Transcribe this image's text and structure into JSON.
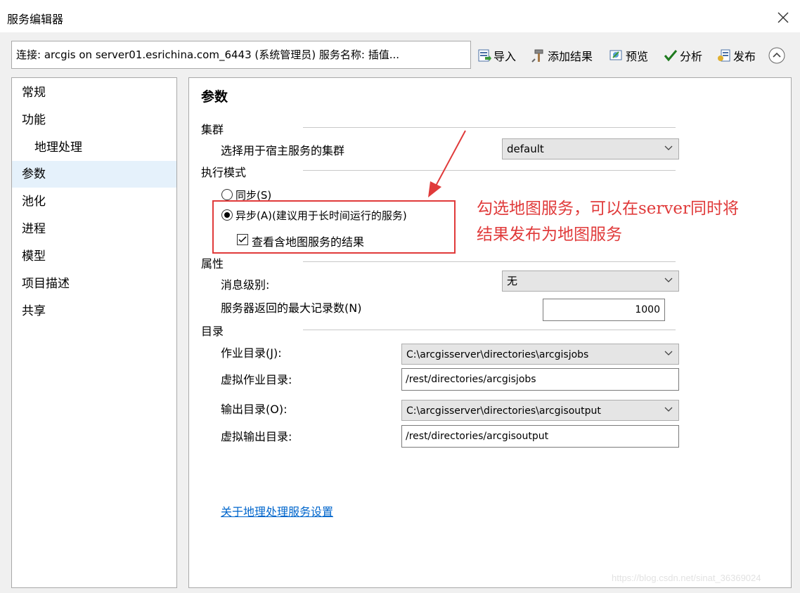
{
  "window": {
    "title": "服务编辑器"
  },
  "toolbar": {
    "connection_text": "连接: arcgis on server01.esrichina.com_6443 (系统管理员)   服务名称: 插值...",
    "import_label": "导入",
    "add_result_label": "添加结果",
    "preview_label": "预览",
    "analyze_label": "分析",
    "publish_label": "发布"
  },
  "sidebar": {
    "items": [
      {
        "label": "常规"
      },
      {
        "label": "功能"
      },
      {
        "label": "地理处理"
      },
      {
        "label": "参数",
        "selected": true
      },
      {
        "label": "池化"
      },
      {
        "label": "进程"
      },
      {
        "label": "模型"
      },
      {
        "label": "项目描述"
      },
      {
        "label": "共享"
      }
    ]
  },
  "panel": {
    "heading": "参数",
    "cluster": {
      "section": "集群",
      "label": "选择用于宿主服务的集群",
      "value": "default"
    },
    "execution": {
      "section": "执行模式",
      "sync_label": "同步(S)",
      "async_label": "异步(A)(建议用于长时间运行的服务)",
      "selected": "async",
      "map_result_label": "查看含地图服务的结果",
      "map_result_checked": true
    },
    "properties": {
      "section": "属性",
      "message_level_label": "消息级别:",
      "message_level_value": "无",
      "max_records_label": "服务器返回的最大记录数(N)",
      "max_records_value": "1000"
    },
    "directories": {
      "section": "目录",
      "job_dir_label": "作业目录(J):",
      "job_dir_value": "C:\\arcgisserver\\directories\\arcgisjobs",
      "virtual_job_dir_label": "虚拟作业目录:",
      "virtual_job_dir_value": "/rest/directories/arcgisjobs",
      "output_dir_label": "输出目录(O):",
      "output_dir_value": "C:\\arcgisserver\\directories\\arcgisoutput",
      "virtual_output_dir_label": "虚拟输出目录:",
      "virtual_output_dir_value": "/rest/directories/arcgisoutput"
    },
    "help_link": "关于地理处理服务设置"
  },
  "annotation": {
    "line1": "勾选地图服务，可以在server同时将",
    "line2": "结果发布为地图服务",
    "color": "#e03a3a"
  },
  "watermark": "https://blog.csdn.net/sinat_36369024"
}
